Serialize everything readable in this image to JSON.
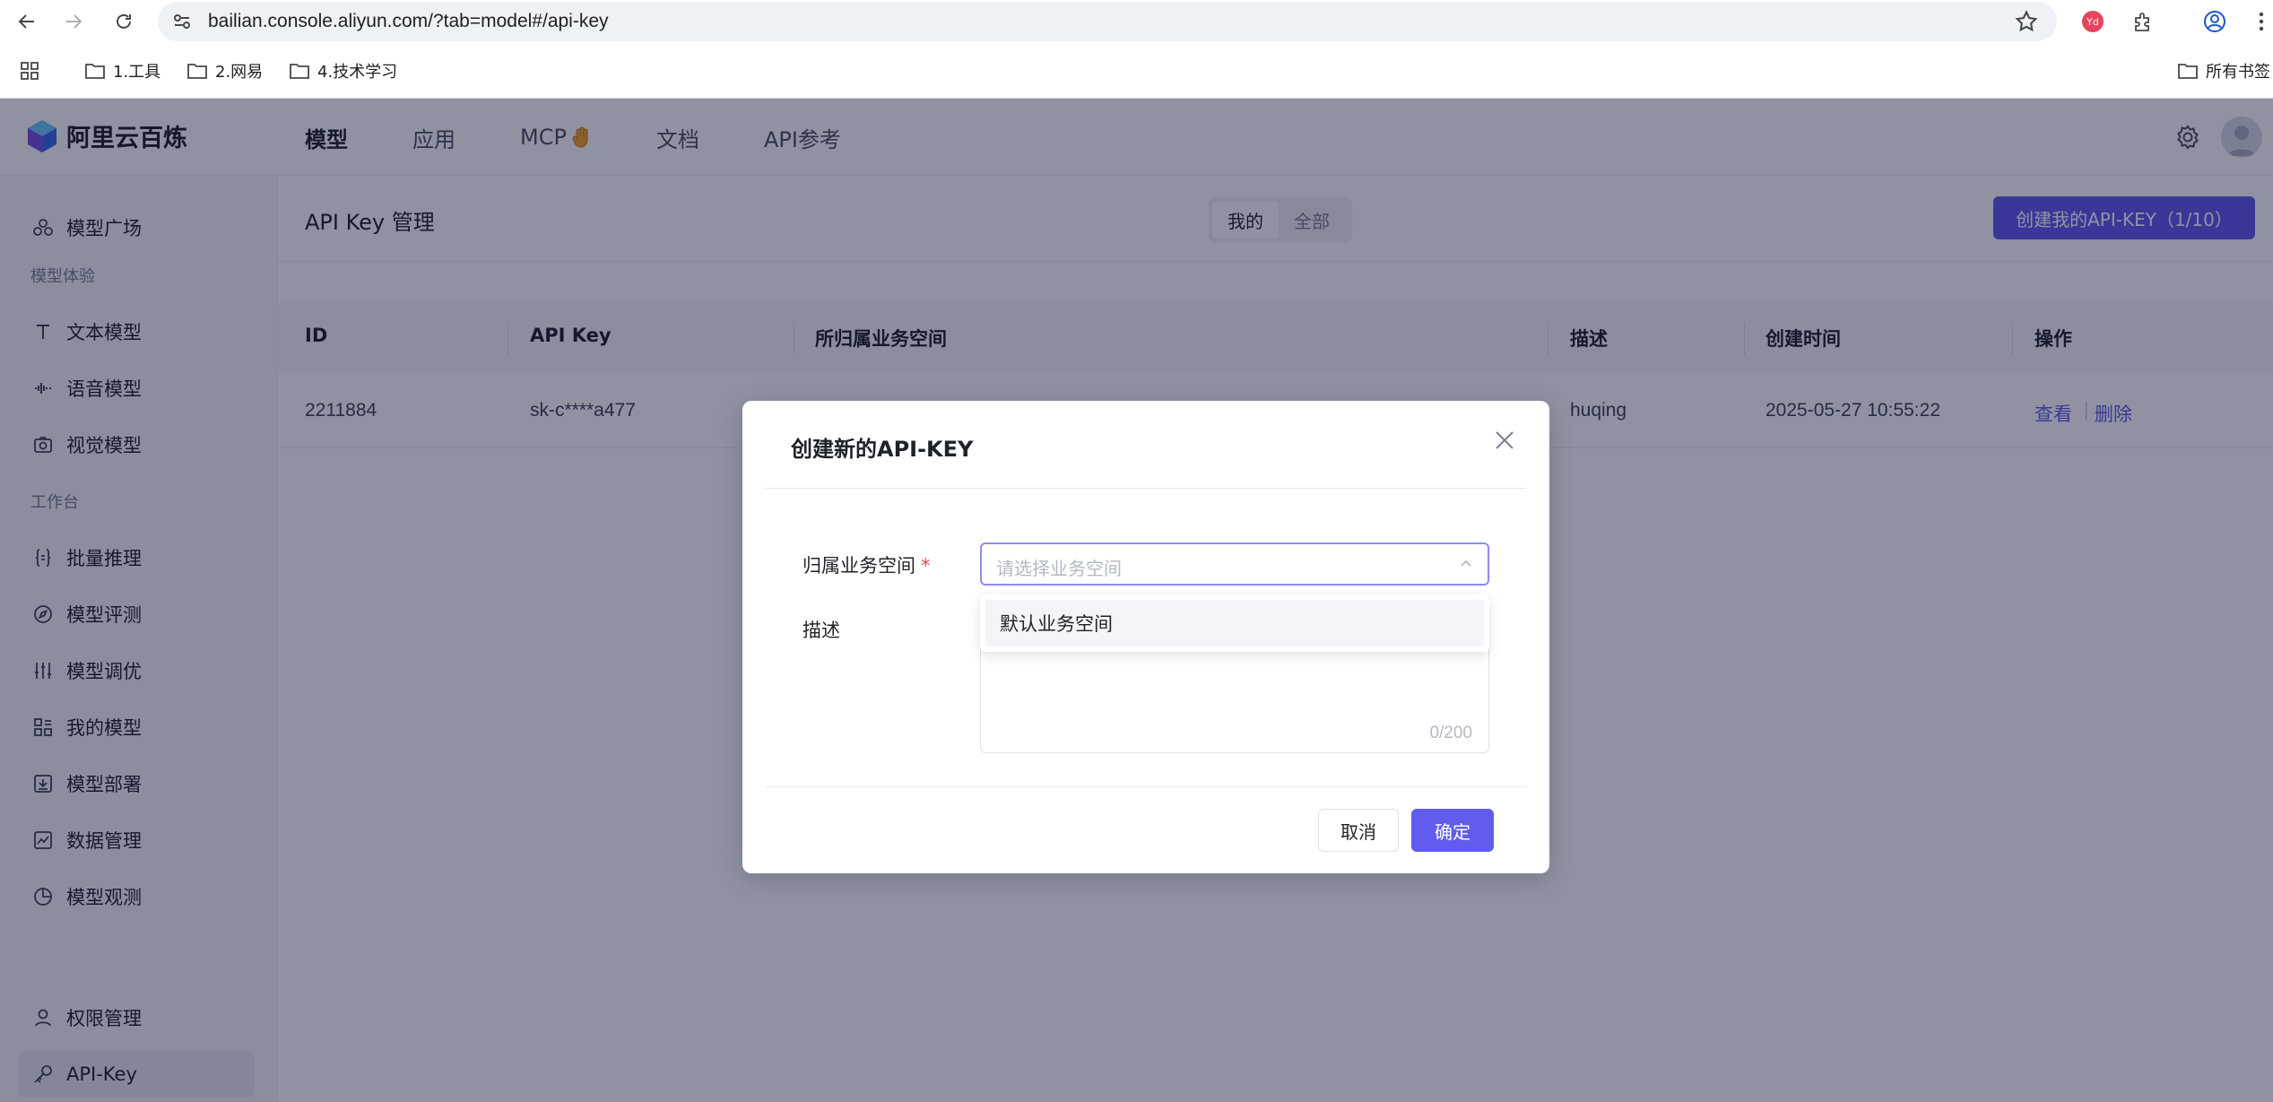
{
  "browser": {
    "url": "bailian.console.aliyun.com/?tab=model#/api-key",
    "bookmarks": [
      "1.工具",
      "2.网易",
      "4.技术学习"
    ],
    "all_bookmarks": "所有书签"
  },
  "app": {
    "logo_text": "阿里云百炼",
    "top_nav": [
      "模型",
      "应用",
      "MCP",
      "文档",
      "API参考"
    ],
    "top_nav_active": "模型"
  },
  "sidebar": {
    "items": [
      {
        "label": "模型广场",
        "icon": "model-square-icon"
      },
      {
        "section": "模型体验"
      },
      {
        "label": "文本模型",
        "icon": "text-icon"
      },
      {
        "label": "语音模型",
        "icon": "audio-wave-icon"
      },
      {
        "label": "视觉模型",
        "icon": "camera-icon"
      },
      {
        "section": "工作台"
      },
      {
        "label": "批量推理",
        "icon": "braces-icon"
      },
      {
        "label": "模型评测",
        "icon": "compass-icon"
      },
      {
        "label": "模型调优",
        "icon": "sliders-icon"
      },
      {
        "label": "我的模型",
        "icon": "grid-icon"
      },
      {
        "label": "模型部署",
        "icon": "download-box-icon"
      },
      {
        "label": "数据管理",
        "icon": "chart-icon"
      },
      {
        "label": "模型观测",
        "icon": "pie-icon"
      },
      {
        "label": "权限管理",
        "icon": "user-icon"
      },
      {
        "label": "API-Key",
        "icon": "key-icon",
        "active": true
      }
    ]
  },
  "page": {
    "title": "API Key 管理",
    "segment": [
      "我的",
      "全部"
    ],
    "segment_active": "我的",
    "create_button": "创建我的API-KEY（1/10）"
  },
  "table": {
    "columns": [
      "ID",
      "API Key",
      "所归属业务空间",
      "描述",
      "创建时间",
      "操作"
    ],
    "rows": [
      {
        "id": "2211884",
        "api_key": "sk-c****a477",
        "workspace": "",
        "desc": "huqing",
        "created": "2025-05-27 10:55:22",
        "actions": [
          "查看",
          "删除"
        ]
      }
    ]
  },
  "modal": {
    "title": "创建新的API-KEY",
    "workspace_label": "归属业务空间",
    "required_mark": "*",
    "workspace_placeholder": "请选择业务空间",
    "dropdown_option": "默认业务空间",
    "desc_label": "描述",
    "desc_counter": "0/200",
    "cancel": "取消",
    "confirm": "确定"
  },
  "colors": {
    "accent": "#615ced",
    "mask": "rgba(8,13,48,0.45)"
  }
}
